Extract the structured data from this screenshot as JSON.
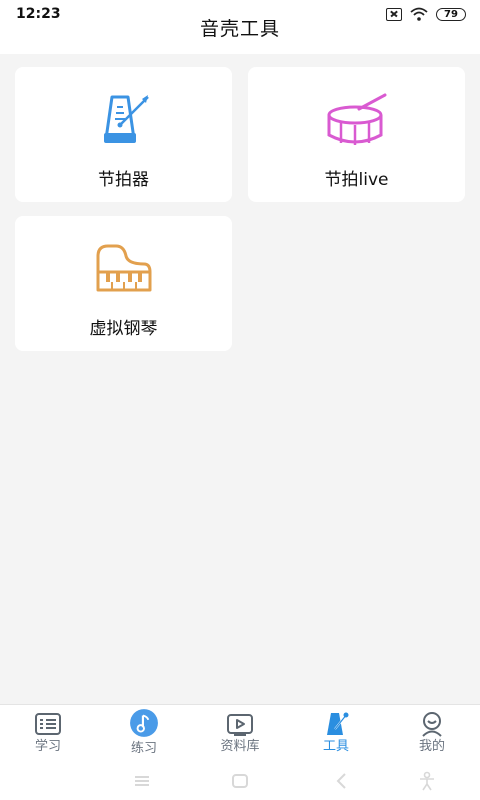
{
  "status": {
    "time": "12:23",
    "battery": "79"
  },
  "header": {
    "title": "音壳工具"
  },
  "tools": [
    {
      "label": "节拍器",
      "icon": "metronome-icon"
    },
    {
      "label": "节拍live",
      "icon": "drum-icon"
    },
    {
      "label": "虚拟钢琴",
      "icon": "piano-icon"
    }
  ],
  "tabs": [
    {
      "label": "学习",
      "icon": "study-list-icon"
    },
    {
      "label": "练习",
      "icon": "music-note-icon"
    },
    {
      "label": "资料库",
      "icon": "video-library-icon"
    },
    {
      "label": "工具",
      "icon": "metronome-icon",
      "active": true
    },
    {
      "label": "我的",
      "icon": "profile-icon"
    }
  ],
  "colors": {
    "accent": "#2a8ee0",
    "metronome": "#3b93e3",
    "drum": "#d95ad1",
    "piano": "#e2a04e",
    "tab_inactive": "#6b7480"
  }
}
